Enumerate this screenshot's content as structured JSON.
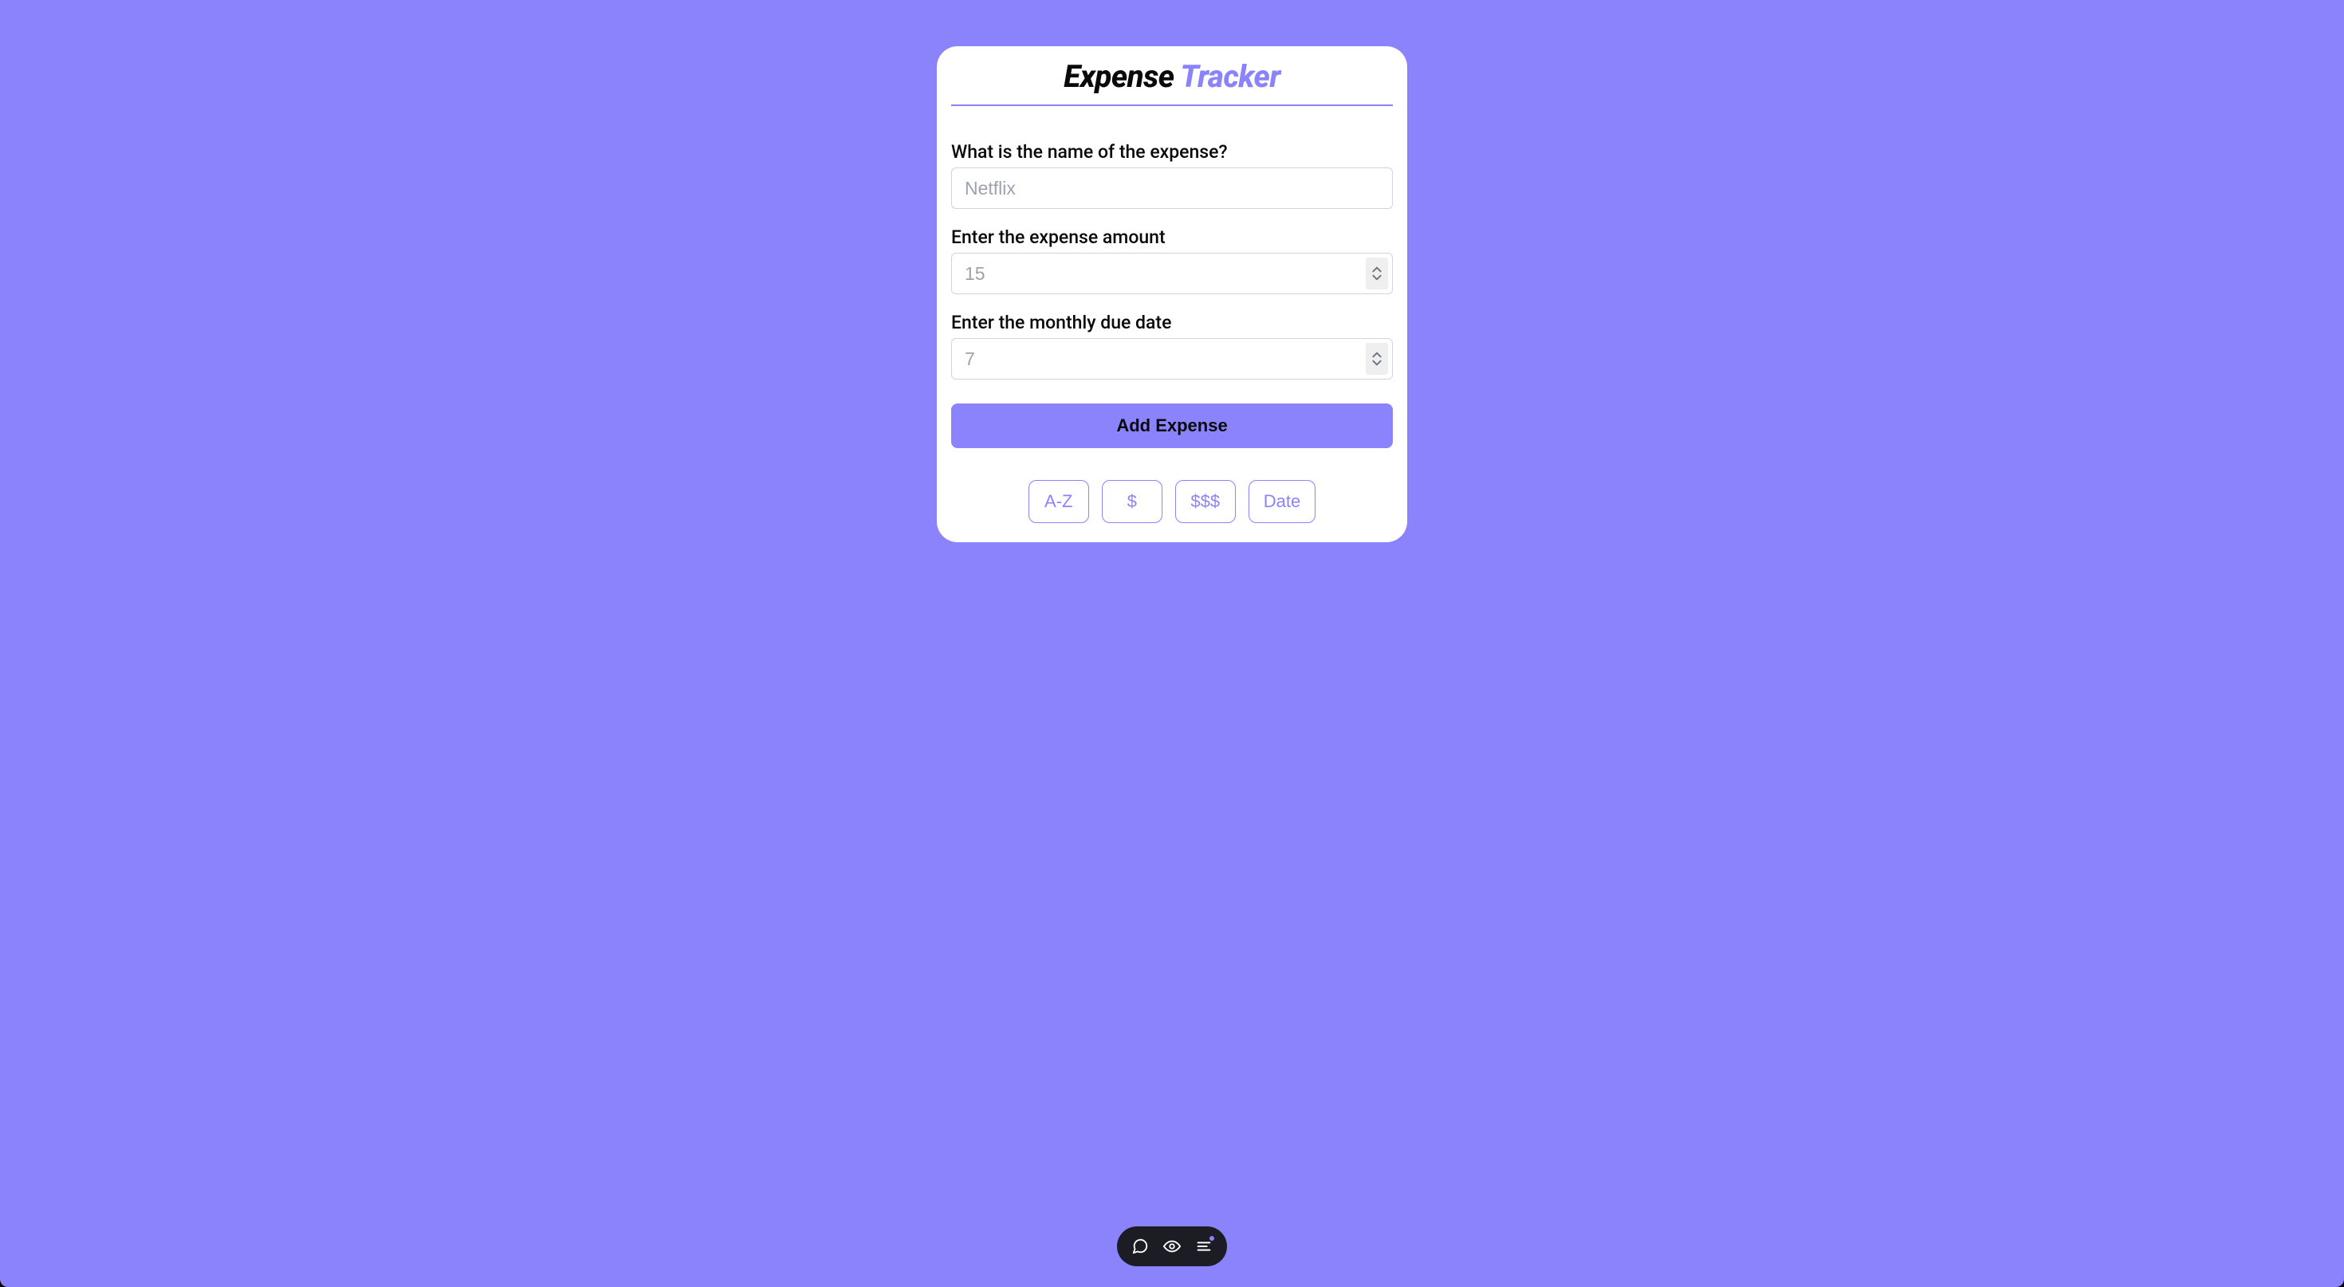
{
  "title": {
    "word1": "Expense",
    "word2": "Tracker"
  },
  "form": {
    "name": {
      "label": "What is the name of the expense?",
      "placeholder": "Netflix",
      "value": ""
    },
    "amount": {
      "label": "Enter the expense amount",
      "placeholder": "15",
      "value": ""
    },
    "due": {
      "label": "Enter the monthly due date",
      "placeholder": "7",
      "value": ""
    },
    "submit_label": "Add Expense"
  },
  "sort": {
    "az": "A-Z",
    "low": "$",
    "high": "$$$",
    "date": "Date"
  }
}
